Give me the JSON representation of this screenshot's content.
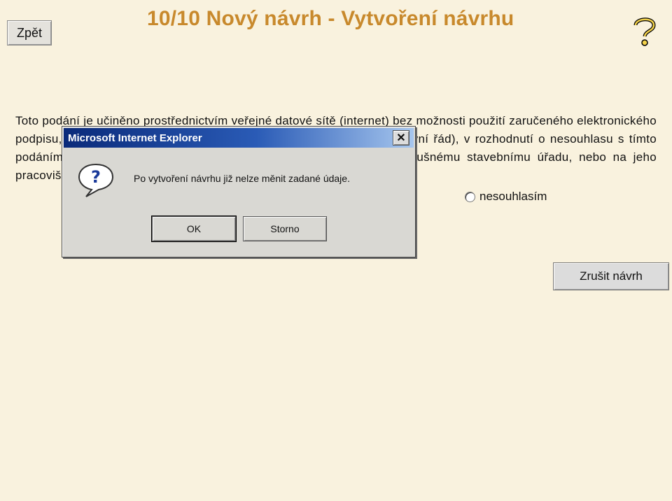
{
  "header": {
    "back_label": "Zpět",
    "title": "10/10 Nový návrh - Vytvoření návrhu",
    "help_icon": "question-mark-icon"
  },
  "main": {
    "notice_text": "Toto podání je učiněno prostřednictvím veřejné datové sítě (internet) bez možnosti použití zaručeného elektronického podpisu, a proto je nutné jej podle § 37 zákona č. 500/2004 Sb. (správní řád), v rozhodnutí o nesouhlasu s tímto podáním potvrdit a v zákonem vyžadované lhůtě doručit místně příslušnému stavebnímu úřadu, nebo na jeho pracovišti.",
    "radio_label": "nesouhlasím",
    "cancel_button_label": "Zrušit návrh"
  },
  "dialog": {
    "title": "Microsoft Internet Explorer",
    "close_label": "✕",
    "icon": "question-icon",
    "message": "Po vytvoření návrhu již nelze měnit zadané údaje.",
    "ok_label": "OK",
    "cancel_label": "Storno"
  },
  "colors": {
    "page_background": "#f9f2de",
    "title_color": "#c8892c",
    "dialog_title_start": "#0a2a7a",
    "dialog_title_end": "#a6c6ee"
  }
}
